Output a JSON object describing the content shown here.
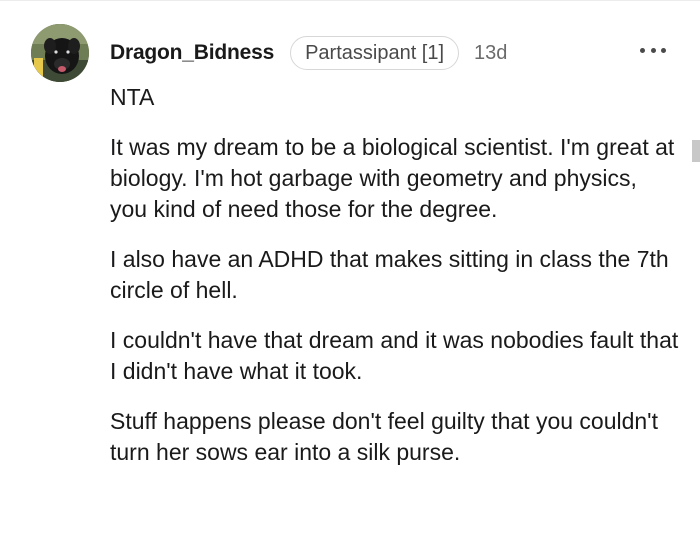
{
  "comment": {
    "author": "Dragon_Bidness",
    "flair": "Partassipant [1]",
    "timestamp": "13d",
    "more_icon": "more-horizontal-icon",
    "paragraphs": [
      "NTA",
      "It was my dream to be a biological scientist. I'm great at biology. I'm hot garbage with geometry and physics, you kind of need those for the degree.",
      "I also have an ADHD that makes sitting in class the 7th circle of hell.",
      "I couldn't have that dream and it was nobodies fault that I didn't have what it took.",
      "Stuff happens please don't feel guilty that you couldn't turn her sows ear into a silk purse."
    ]
  },
  "colors": {
    "text": "#1a1a1b",
    "meta": "#6b6b6b",
    "flair_border": "#d7d7d7"
  }
}
